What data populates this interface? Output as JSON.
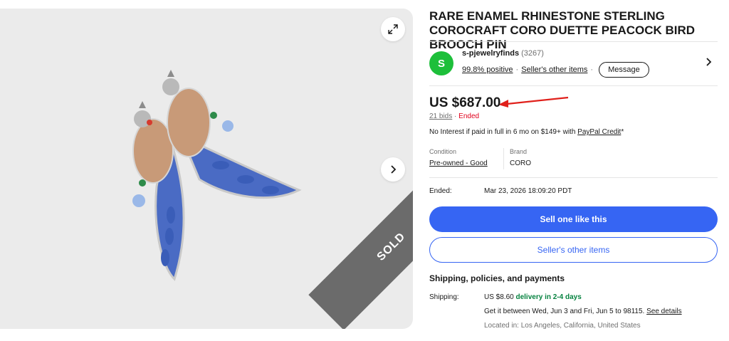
{
  "listing": {
    "title": "RARE ENAMEL RHINESTONE STERLING COROCRAFT CORO DUETTE PEACOCK BIRD BROOCH PIN",
    "sold_banner": "SOLD",
    "image_alt_icon": "peacock-brooch-photo"
  },
  "seller": {
    "avatar_letter": "S",
    "name": "s-pjewelryfinds",
    "feedback_count": "(3267)",
    "positive": "99.8% positive",
    "other_items_link": "Seller's other items",
    "message_button": "Message"
  },
  "price": {
    "amount": "US $687.00",
    "bids": "21 bids",
    "separator": "·",
    "status": "Ended",
    "financing_text": "No Interest if paid in full in 6 mo on $149+ with ",
    "financing_link": "PayPal Credit",
    "financing_suffix": "*"
  },
  "item_specifics": {
    "condition_label": "Condition",
    "condition_value": "Pre-owned - Good",
    "brand_label": "Brand",
    "brand_value": "CORO"
  },
  "ended": {
    "label": "Ended:",
    "value": "Mar 23, 2026 18:09:20 PDT"
  },
  "actions": {
    "primary": "Sell one like this",
    "secondary": "Seller's other items"
  },
  "shipping": {
    "heading": "Shipping, policies, and payments",
    "label": "Shipping:",
    "cost": "US $8.60 ",
    "delivery": "delivery in 2-4 days",
    "estimate": "Get it between Wed, Jun 3 and Fri, Jun 5 to 98115. ",
    "details_link": "See details",
    "location": "Located in: Los Angeles, California, United States"
  },
  "colors": {
    "primary_blue": "#3665f3",
    "ended_red": "#e0001b",
    "delivery_green": "#05823f",
    "avatar_green": "#1dbf3a",
    "annotation_arrow": "#e0201b"
  }
}
